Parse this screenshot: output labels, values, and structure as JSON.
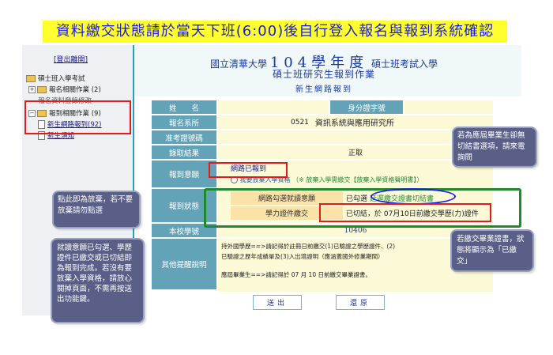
{
  "banner": {
    "text": "資料繳交狀態請於當天下班(6:00)後自行登入報名與報到系統確認"
  },
  "sidebar": {
    "logout": "[登出離開]",
    "tree": [
      {
        "label": "碩士班入學考試",
        "count": ""
      },
      {
        "label": "報名相關作業",
        "count": "(2)"
      },
      {
        "label": "報名資料登錄修改",
        "count": ""
      },
      {
        "label": "報到相關作業",
        "count": "(9)"
      },
      {
        "label": "新生網路報到",
        "count": "(92)"
      },
      {
        "label": "新生須知",
        "count": ""
      }
    ]
  },
  "header": {
    "line1_pre": "國立清華大學",
    "line1_big": "104學年度",
    "line1_post": "碩士班考試入學",
    "line2": "碩士班研究生報到作業",
    "line3": "新生網路報到"
  },
  "form": {
    "name_label": "姓　　名",
    "name_value": "",
    "id_label": "身分證字號",
    "id_value": "",
    "dept_label": "報名系所",
    "dept_code": "0521",
    "dept_name": "資訊系統與應用研究所",
    "exam_label": "准考證號碼",
    "exam_value": "",
    "result_label": "錄取結果",
    "result_value": "正取",
    "intent_label": "報到意願",
    "intent_value": "網路已報到",
    "intent_option": "我要放棄入學資格",
    "intent_option_note": "（※ 放棄入學需繳交【放棄入學資格聲明書】）",
    "status_label": "報到狀態",
    "status_sub1_label": "網路勾選就讀意願",
    "status_sub1_value": "已勾選",
    "status_sub1_link": "延遲繳交證書切結書",
    "status_sub2_label": "學力證件繳交",
    "status_sub2_value": "已切結，於 07月10日前繳交學歷(力)證件",
    "student_label": "本校學號",
    "student_value": "10406",
    "remark_label": "其他提醒說明",
    "remark_line1": "持外國學歷==>請記得於註冊日前繳交(1)已驗證之學歷證件、(2)",
    "remark_line2": "已驗證之歷年成績單及(3)入出境證明（應涵蓋國外修業期間）",
    "remark_line3": "應屆畢業生==>請記得於 07 月 10 日前繳交畢業證書。",
    "submit": "送出",
    "reset": "還原"
  },
  "callouts": {
    "abandon": "點此即為放棄，若不要放棄請勿點選",
    "check": "就讀意願已勾選、學歷證件已繳交或已切結即為報到完成。若沒有要放棄入學資格，請放心關掉頁面，不需再按送出功能鍵。",
    "check_red": "報到完成",
    "graduate": "若為應屆畢業生卻無切結書選項，請來電詢問",
    "submitted": "若繳交畢業證書，狀態將顯示為「已繳交」"
  },
  "colors": {
    "accent": "#63a3b7",
    "banner_bg": "#ffff2e",
    "banner_fg": "#1a1adb",
    "highlight": "#e31b1b",
    "status_box": "#1d8b2c"
  }
}
